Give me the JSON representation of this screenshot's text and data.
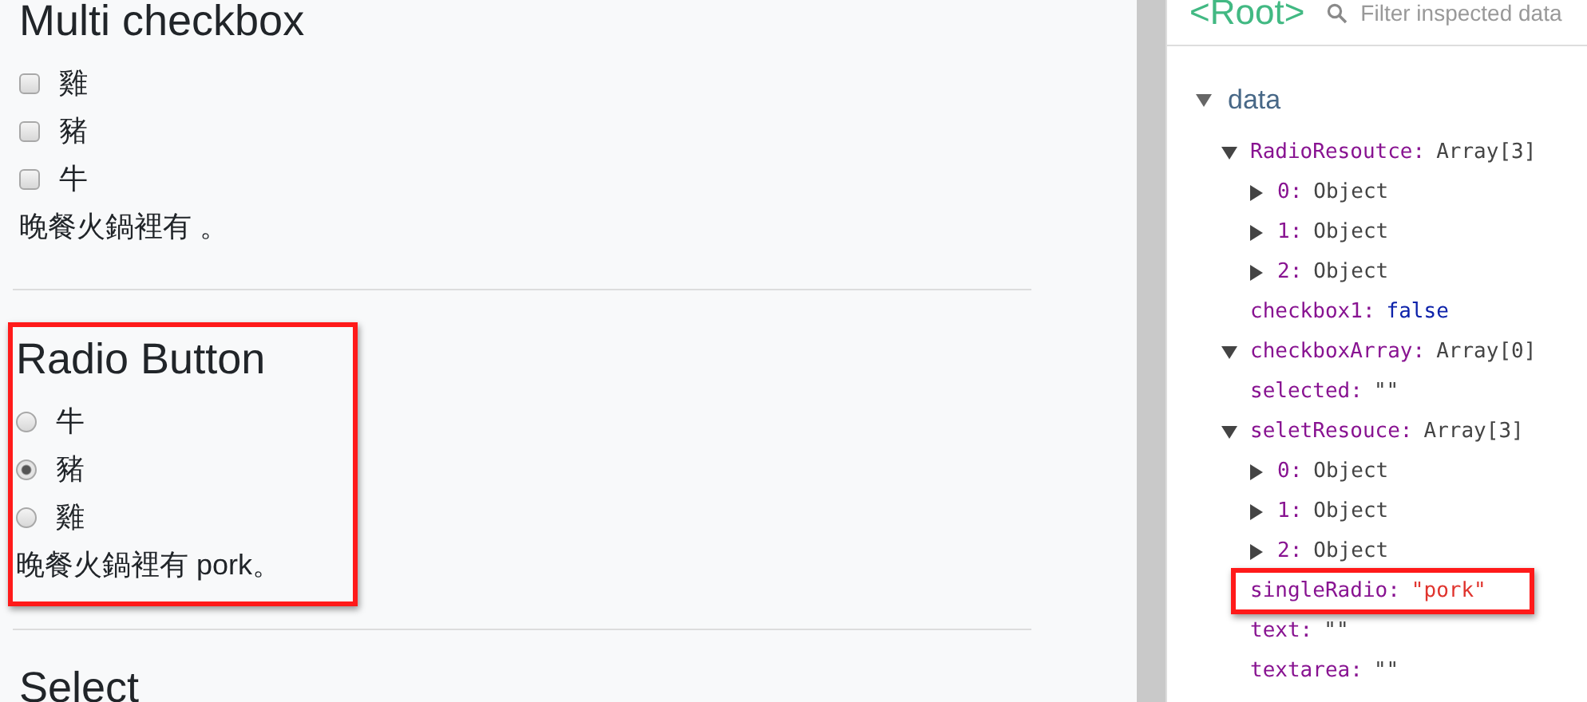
{
  "sections": [
    {
      "kind": "checkbox",
      "heading": "Multi checkbox",
      "options": [
        {
          "label": "雞",
          "selected": false
        },
        {
          "label": "豬",
          "selected": false
        },
        {
          "label": "牛",
          "selected": false
        }
      ],
      "sentence": "晚餐火鍋裡有 。"
    },
    {
      "kind": "radio",
      "heading": "Radio Button",
      "highlighted": true,
      "options": [
        {
          "label": "牛",
          "selected": false
        },
        {
          "label": "豬",
          "selected": true
        },
        {
          "label": "雞",
          "selected": false
        }
      ],
      "sentence": "晚餐火鍋裡有 pork。"
    },
    {
      "kind": "heading",
      "heading": "Select"
    }
  ],
  "inspector": {
    "root": "<Root>",
    "search": {
      "placeholder": "Filter inspected data"
    },
    "tree": {
      "label": "data",
      "expanded": true,
      "children": [
        {
          "key": "RadioResoutce:",
          "value": "Array[3]",
          "kind": "object",
          "expanded": true,
          "children": [
            {
              "key": "0:",
              "value": "Object",
              "kind": "object",
              "expanded": false
            },
            {
              "key": "1:",
              "value": "Object",
              "kind": "object",
              "expanded": false
            },
            {
              "key": "2:",
              "value": "Object",
              "kind": "object",
              "expanded": false
            }
          ]
        },
        {
          "key": "checkbox1:",
          "value": "false",
          "kind": "boolean"
        },
        {
          "key": "checkboxArray:",
          "value": "Array[0]",
          "kind": "object",
          "expanded": true
        },
        {
          "key": "selected:",
          "value": "\"\"",
          "kind": "plain"
        },
        {
          "key": "seletResouce:",
          "value": "Array[3]",
          "kind": "object",
          "expanded": true,
          "children": [
            {
              "key": "0:",
              "value": "Object",
              "kind": "object",
              "expanded": false
            },
            {
              "key": "1:",
              "value": "Object",
              "kind": "object",
              "expanded": false
            },
            {
              "key": "2:",
              "value": "Object",
              "kind": "object",
              "expanded": false
            }
          ]
        },
        {
          "key": "singleRadio:",
          "value": "\"pork\"",
          "kind": "string",
          "highlighted": true
        },
        {
          "key": "text:",
          "value": "\"\"",
          "kind": "plain"
        },
        {
          "key": "textarea:",
          "value": "\"\"",
          "kind": "plain"
        }
      ]
    }
  }
}
